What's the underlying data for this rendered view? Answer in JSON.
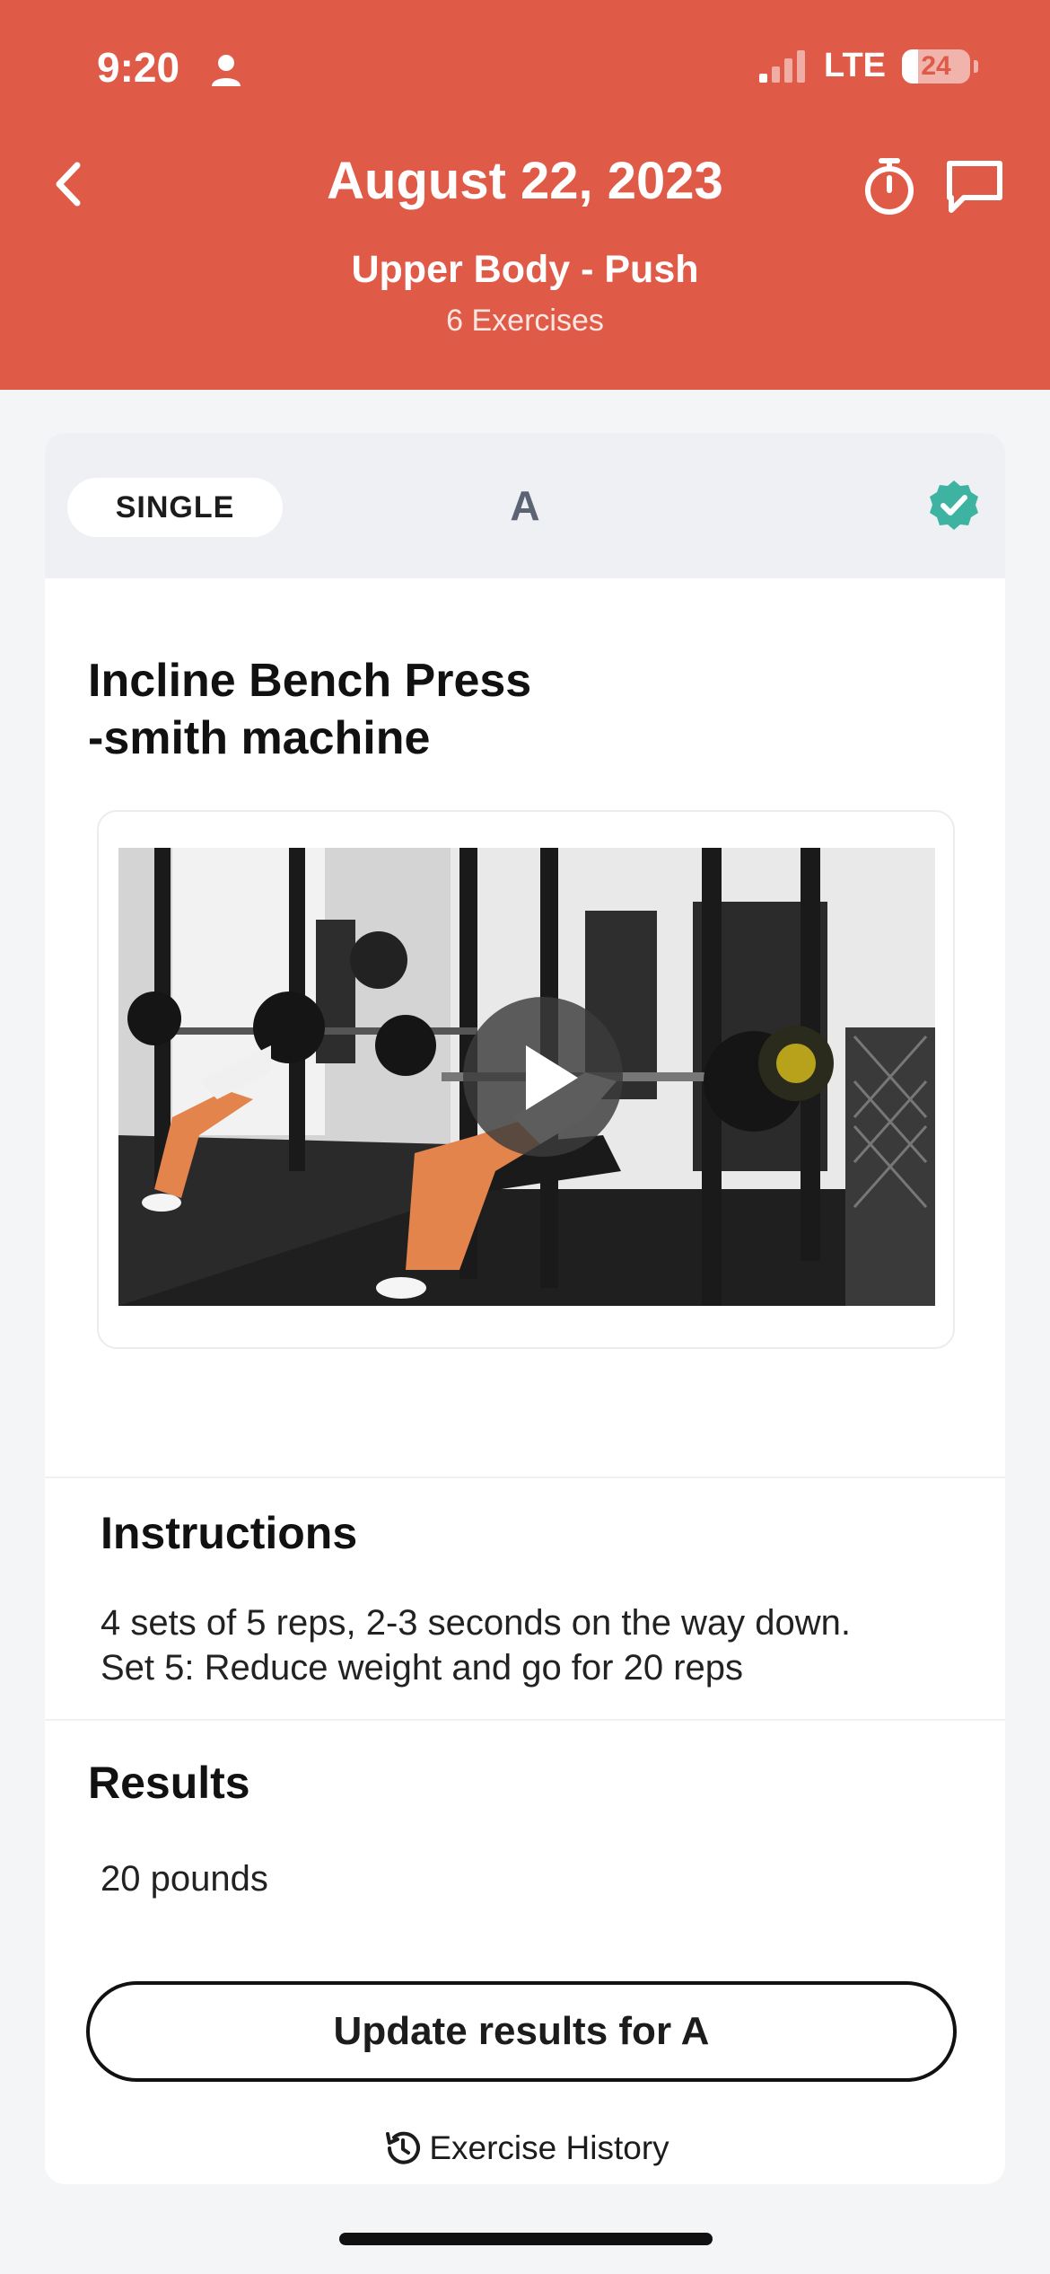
{
  "status": {
    "time": "9:20",
    "network": "LTE",
    "battery": "24",
    "battery_level": 0.24
  },
  "header": {
    "title": "August 22, 2023",
    "subtitle": "Upper Body - Push",
    "count": "6 Exercises",
    "icons": [
      "chevron-left-icon",
      "stopwatch-icon",
      "chat-bubble-icon"
    ]
  },
  "exercise": {
    "type": "SINGLE",
    "letter": "A",
    "status_icon": "check-badge-icon",
    "title_line1": "Incline Bench Press",
    "title_line2": "-smith machine"
  },
  "instructions": {
    "title": "Instructions",
    "line1": "4 sets of 5 reps, 2-3 seconds on the way down.",
    "line2": "Set 5: Reduce weight and go for 20 reps"
  },
  "results": {
    "title": "Results",
    "value": "20 pounds",
    "update_label": "Update results for A",
    "history_label": "Exercise History"
  },
  "colors": {
    "accent": "#e05a48",
    "check": "#3fb3a2"
  }
}
